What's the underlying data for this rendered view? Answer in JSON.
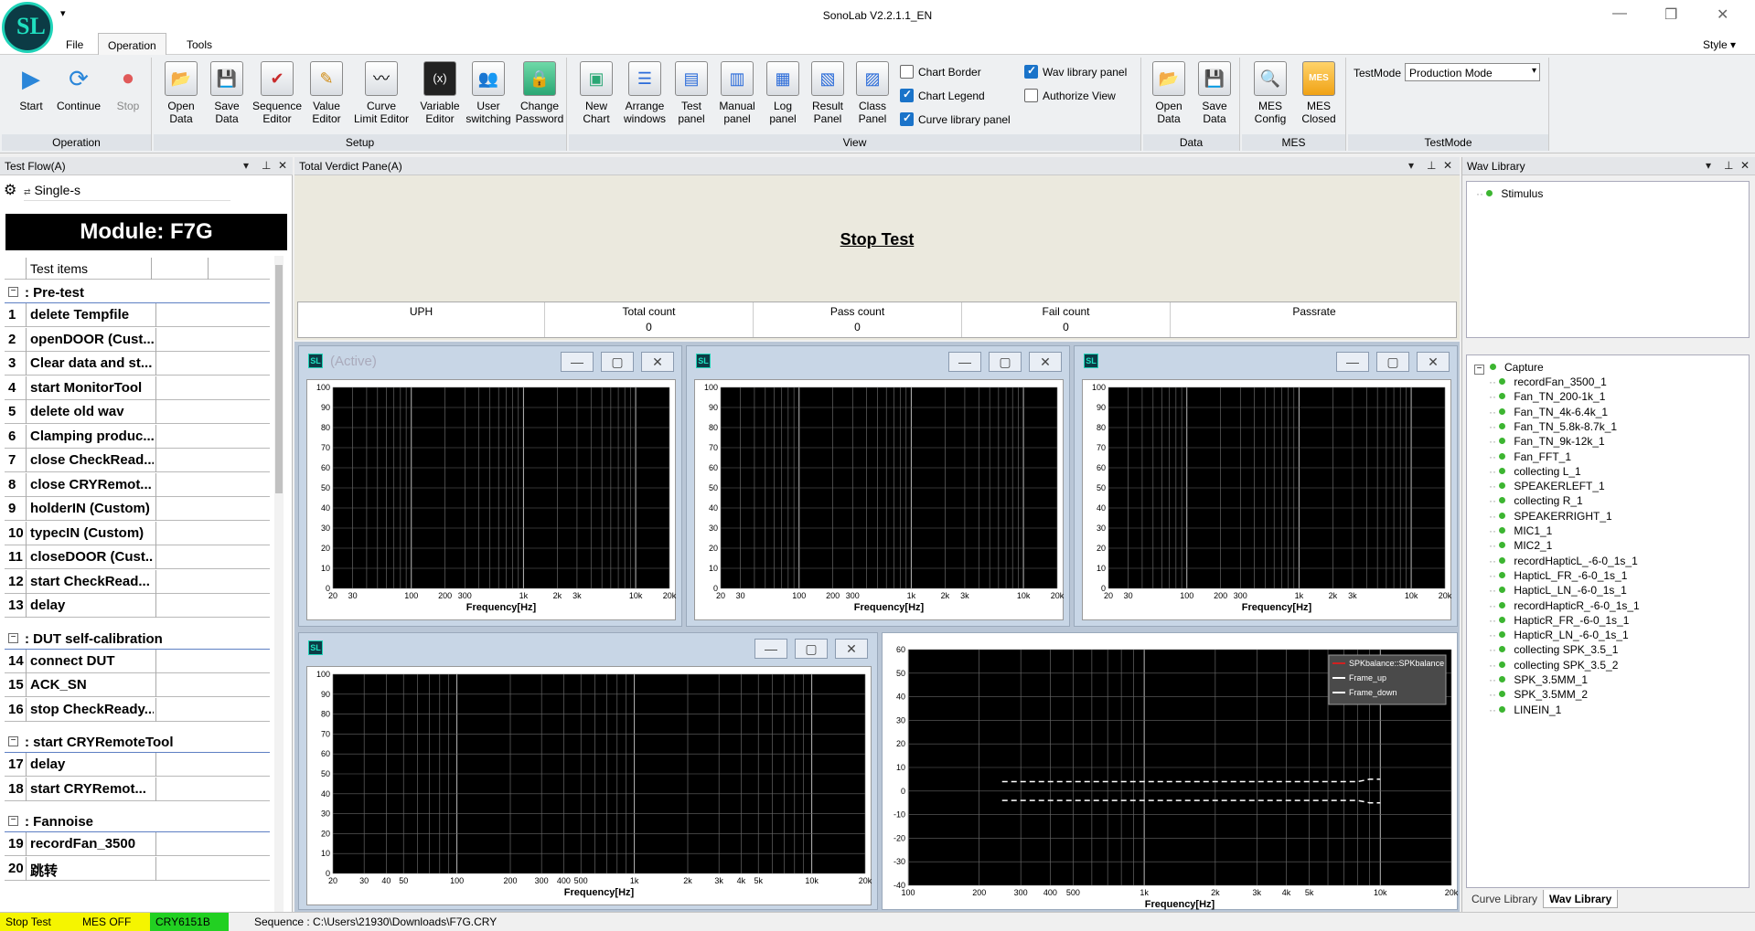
{
  "app": {
    "title": "SonoLab V2.2.1.1_EN",
    "logo_text": "SL"
  },
  "menu": {
    "items": [
      "File",
      "Operation",
      "Tools"
    ],
    "active": "Operation",
    "style": "Style"
  },
  "ribbon": {
    "operation": {
      "label": "Operation",
      "buttons": [
        "Start",
        "Continue",
        "Stop"
      ]
    },
    "setup": {
      "label": "Setup",
      "buttons": [
        {
          "l1": "Open",
          "l2": "Data"
        },
        {
          "l1": "Save",
          "l2": "Data"
        },
        {
          "l1": "Sequence",
          "l2": "Editor"
        },
        {
          "l1": "Value",
          "l2": "Editor"
        },
        {
          "l1": "Curve",
          "l2": "Limit Editor"
        },
        {
          "l1": "Variable",
          "l2": "Editor"
        },
        {
          "l1": "User",
          "l2": "switching"
        },
        {
          "l1": "Change",
          "l2": "Password"
        }
      ]
    },
    "view": {
      "label": "View",
      "buttons": [
        {
          "l1": "New",
          "l2": "Chart"
        },
        {
          "l1": "Arrange",
          "l2": "windows"
        },
        {
          "l1": "Test",
          "l2": "panel"
        },
        {
          "l1": "Manual",
          "l2": "panel"
        },
        {
          "l1": "Log",
          "l2": "panel"
        },
        {
          "l1": "Result",
          "l2": "Panel"
        },
        {
          "l1": "Class",
          "l2": "Panel"
        }
      ],
      "checks": [
        {
          "label": "Chart Border",
          "on": false
        },
        {
          "label": "Chart Legend",
          "on": true
        },
        {
          "label": "Curve library panel",
          "on": true
        },
        {
          "label": "Wav library panel",
          "on": true
        },
        {
          "label": "Authorize View",
          "on": false
        }
      ]
    },
    "data": {
      "label": "Data",
      "buttons": [
        {
          "l1": "Open",
          "l2": "Data"
        },
        {
          "l1": "Save",
          "l2": "Data"
        }
      ]
    },
    "mes": {
      "label": "MES",
      "buttons": [
        {
          "l1": "MES",
          "l2": "Config"
        },
        {
          "l1": "MES",
          "l2": "Closed"
        }
      ]
    },
    "testmode": {
      "label": "TestMode",
      "field_label": "TestMode",
      "value": "Production Mode"
    }
  },
  "testflow": {
    "title": "Test Flow(A)",
    "selector": "Single-s",
    "module": "Module: F7G",
    "col_header": "Test items",
    "groups": [
      {
        "name": ": Pre-test",
        "items": [
          {
            "n": "1",
            "t": "delete Tempfile"
          },
          {
            "n": "2",
            "t": "openDOOR (Cust..."
          },
          {
            "n": "3",
            "t": "Clear data and st..."
          },
          {
            "n": "4",
            "t": "start MonitorTool"
          },
          {
            "n": "5",
            "t": "delete old wav"
          },
          {
            "n": "6",
            "t": "Clamping produc..."
          },
          {
            "n": "7",
            "t": "close CheckRead..."
          },
          {
            "n": "8",
            "t": "close CRYRemot..."
          },
          {
            "n": "9",
            "t": "holderIN (Custom)"
          },
          {
            "n": "10",
            "t": "typecIN (Custom)"
          },
          {
            "n": "11",
            "t": "closeDOOR (Cust..."
          },
          {
            "n": "12",
            "t": "start CheckRead..."
          },
          {
            "n": "13",
            "t": "delay"
          }
        ]
      },
      {
        "name": ": DUT self-calibration",
        "items": [
          {
            "n": "14",
            "t": "connect DUT"
          },
          {
            "n": "15",
            "t": "ACK_SN"
          },
          {
            "n": "16",
            "t": "stop CheckReady..."
          }
        ]
      },
      {
        "name": ": start CRYRemoteTool",
        "items": [
          {
            "n": "17",
            "t": "delay"
          },
          {
            "n": "18",
            "t": "start CRYRemot..."
          }
        ]
      },
      {
        "name": ": Fannoise",
        "items": [
          {
            "n": "19",
            "t": "recordFan_3500"
          },
          {
            "n": "20",
            "t": "跳转"
          }
        ]
      }
    ]
  },
  "verdict": {
    "title": "Total Verdict Pane(A)",
    "status": "Stop Test",
    "headers": [
      "UPH",
      "Total count",
      "Pass count",
      "Fail count",
      "Passrate"
    ],
    "values": [
      "",
      "0",
      "0",
      "0",
      ""
    ]
  },
  "charts": {
    "active_label": "(Active)",
    "xlabel": "Frequency[Hz]"
  },
  "chart_data": [
    {
      "type": "line",
      "xlabel": "Frequency[Hz]",
      "xscale": "log",
      "xlim": [
        20,
        20000
      ],
      "ylim": [
        0,
        100
      ],
      "xticks": [
        "20",
        "30",
        "100",
        "200",
        "300",
        "1k",
        "2k",
        "3k",
        "10k",
        "20k"
      ],
      "yticks": [
        "0",
        "10",
        "20",
        "30",
        "40",
        "50",
        "60",
        "70",
        "80",
        "90",
        "100"
      ],
      "series": []
    },
    {
      "type": "line",
      "xlabel": "Frequency[Hz]",
      "xscale": "log",
      "xlim": [
        20,
        20000
      ],
      "ylim": [
        0,
        100
      ],
      "xticks": [
        "20",
        "30",
        "100",
        "200",
        "300",
        "1k",
        "2k",
        "3k",
        "10k",
        "20k"
      ],
      "yticks": [
        "0",
        "10",
        "20",
        "30",
        "40",
        "50",
        "60",
        "70",
        "80",
        "90",
        "100"
      ],
      "series": []
    },
    {
      "type": "line",
      "xlabel": "Frequency[Hz]",
      "xscale": "log",
      "xlim": [
        20,
        20000
      ],
      "ylim": [
        0,
        100
      ],
      "xticks": [
        "20",
        "30",
        "100",
        "200",
        "300",
        "1k",
        "2k",
        "3k",
        "10k",
        "20k"
      ],
      "yticks": [
        "0",
        "10",
        "20",
        "30",
        "40",
        "50",
        "60",
        "70",
        "80",
        "90",
        "100"
      ],
      "series": []
    },
    {
      "type": "line",
      "xlabel": "Frequency[Hz]",
      "xscale": "log",
      "xlim": [
        20,
        20000
      ],
      "ylim": [
        0,
        100
      ],
      "xticks": [
        "20",
        "30",
        "40",
        "50",
        "100",
        "200",
        "300",
        "400",
        "500",
        "1k",
        "2k",
        "3k",
        "4k",
        "5k",
        "10k",
        "20k"
      ],
      "yticks": [
        "0",
        "10",
        "20",
        "30",
        "40",
        "50",
        "60",
        "70",
        "80",
        "90",
        "100"
      ],
      "series": []
    },
    {
      "type": "line",
      "xlabel": "Frequency[Hz]",
      "xscale": "log",
      "xlim": [
        100,
        20000
      ],
      "ylim": [
        -40,
        60
      ],
      "xticks": [
        "100",
        "200",
        "300",
        "400",
        "500",
        "1k",
        "2k",
        "3k",
        "4k",
        "5k",
        "10k",
        "20k"
      ],
      "yticks": [
        "-40",
        "-30",
        "-20",
        "-10",
        "0",
        "10",
        "20",
        "30",
        "40",
        "50",
        "60"
      ],
      "legend": "top-right",
      "series": [
        {
          "name": "SPKbalance::SPKbalance",
          "color": "#d02020",
          "x": [],
          "y": []
        },
        {
          "name": "Frame_up",
          "color": "#ffffff",
          "dashed": true,
          "x": [
            250,
            400,
            1000,
            2000,
            5000,
            8000,
            8500,
            9000,
            10000
          ],
          "y": [
            4,
            4,
            4,
            4,
            4,
            4,
            4.5,
            5,
            5
          ]
        },
        {
          "name": "Frame_down",
          "color": "#ffffff",
          "dashed": true,
          "x": [
            250,
            400,
            1000,
            2000,
            5000,
            8000,
            8500,
            9000,
            10000
          ],
          "y": [
            -4,
            -4,
            -4,
            -4,
            -4,
            -4,
            -4.5,
            -5,
            -5
          ]
        }
      ]
    }
  ],
  "wav": {
    "title": "Wav Library",
    "stimulus": "Stimulus",
    "capture": "Capture",
    "capture_items": [
      "recordFan_3500_1",
      "Fan_TN_200-1k_1",
      "Fan_TN_4k-6.4k_1",
      "Fan_TN_5.8k-8.7k_1",
      "Fan_TN_9k-12k_1",
      "Fan_FFT_1",
      "collecting L_1",
      "SPEAKERLEFT_1",
      "collecting R_1",
      "SPEAKERRIGHT_1",
      "MIC1_1",
      "MIC2_1",
      "recordHapticL_-6-0_1s_1",
      "HapticL_FR_-6-0_1s_1",
      "HapticL_LN_-6-0_1s_1",
      "recordHapticR_-6-0_1s_1",
      "HapticR_FR_-6-0_1s_1",
      "HapticR_LN_-6-0_1s_1",
      "collecting SPK_3.5_1",
      "collecting SPK_3.5_2",
      "SPK_3.5MM_1",
      "SPK_3.5MM_2",
      "LINEIN_1"
    ],
    "tabs": [
      "Curve Library",
      "Wav Library"
    ]
  },
  "status": {
    "state": "Stop Test",
    "mes": "MES OFF",
    "device": "CRY6151B",
    "sequence": "Sequence : C:\\Users\\21930\\Downloads\\F7G.CRY",
    "colors": {
      "state": "#f5f500",
      "device": "#22d022"
    }
  }
}
